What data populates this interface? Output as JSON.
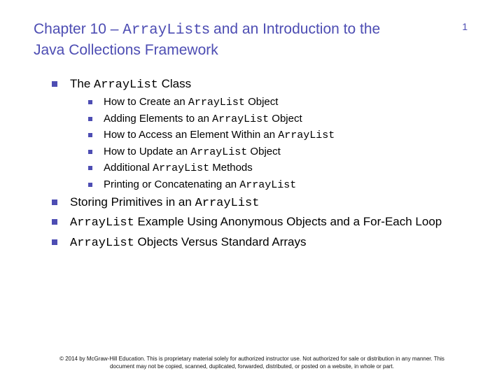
{
  "title": {
    "pre": "Chapter 10 – ",
    "code": "ArrayList",
    "post": "s and an Introduction to the Java Collections Framework"
  },
  "page_number": "1",
  "items": [
    {
      "pre": "The ",
      "code": "ArrayList",
      "post": " Class",
      "sub": [
        {
          "pre": "How to Create an ",
          "code": "ArrayList",
          "post": " Object"
        },
        {
          "pre": "Adding Elements to an ",
          "code": "ArrayList",
          "post": " Object"
        },
        {
          "pre": "How to Access an Element Within an ",
          "code": "ArrayList",
          "post": ""
        },
        {
          "pre": "How to Update an ",
          "code": "ArrayList",
          "post": " Object"
        },
        {
          "pre": "Additional ",
          "code": "ArrayList",
          "post": " Methods"
        },
        {
          "pre": "Printing or Concatenating an ",
          "code": "ArrayList",
          "post": ""
        }
      ]
    },
    {
      "pre": "Storing Primitives in an ",
      "code": "ArrayList",
      "post": ""
    },
    {
      "pre": "",
      "code": "ArrayList",
      "post": " Example Using Anonymous Objects and a For-Each Loop"
    },
    {
      "pre": "",
      "code": "ArrayList",
      "post": " Objects Versus Standard Arrays"
    }
  ],
  "footer": "© 2014 by McGraw-Hill Education. This is proprietary material solely for authorized instructor use. Not authorized for sale or distribution in any manner. This document may not be copied, scanned, duplicated, forwarded, distributed, or posted on a website, in whole or part."
}
